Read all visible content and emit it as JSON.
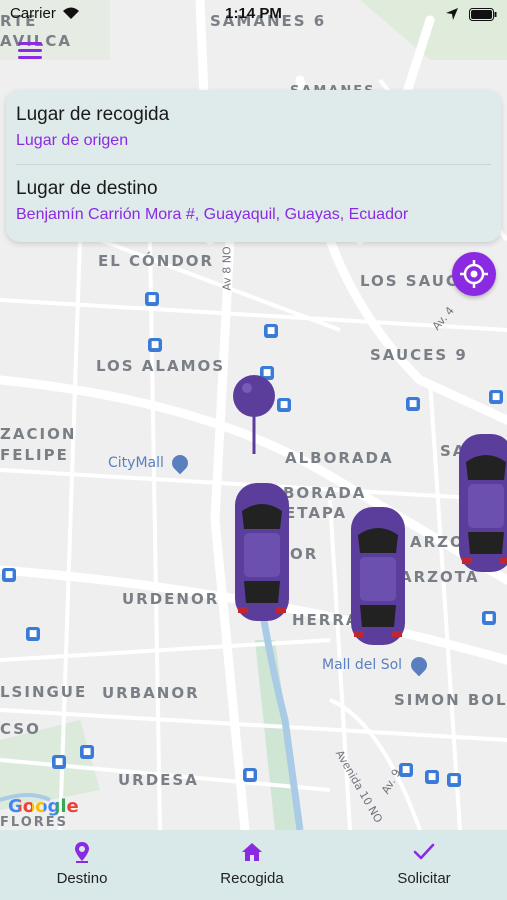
{
  "status_bar": {
    "carrier": "Carrier",
    "time": "1:14 PM"
  },
  "map": {
    "labels": {
      "samanes_6": "SAMANES 6",
      "samanes": "SAMANES",
      "avilca": "AVILCA",
      "el_condor": "EL CÓNDOR",
      "av8no": "Av 8 NO",
      "los_sauces": "LOS SAUCES",
      "av4": "Av. 4",
      "sauces9": "SAUCES 9",
      "los_alamos": "LOS ALAMOS",
      "zacion": "ZACION",
      "felipe": "FELIPE",
      "alborada": "ALBORADA",
      "borada_etapa": "BORADA",
      "etapa": "ETAPA",
      "sa": "SA",
      "arzo": "ARZO",
      "or": "OR",
      "arzota": "ARZOTA",
      "urdenor": "URDENOR",
      "herra": "HERRA",
      "lsingue": "LSINGUE",
      "urbanor": "URBANOR",
      "simon": "SIMON BOLIV",
      "cso": "CSO",
      "urdesa": "URDESA",
      "avenida10": "Avenida 10 NO",
      "av9": "Av. 9",
      "flores": "FLORES",
      "rte": "RTE"
    },
    "pois": {
      "citymall": "CityMall",
      "mall_del_sol": "Mall del Sol"
    },
    "google": "Google",
    "colors": {
      "car": "#5b3e9c",
      "pin": "#6a4fb0"
    }
  },
  "card": {
    "pickup_title": "Lugar de recogida",
    "pickup_value": "Lugar de origen",
    "dest_title": "Lugar de destino",
    "dest_value": "Benjamín Carrión Mora #, Guayaquil, Guayas, Ecuador"
  },
  "tabs": [
    {
      "label": "Destino",
      "icon": "location-pin-icon"
    },
    {
      "label": "Recogida",
      "icon": "home-icon"
    },
    {
      "label": "Solicitar",
      "icon": "check-icon"
    }
  ],
  "accent": "#8a2be2"
}
